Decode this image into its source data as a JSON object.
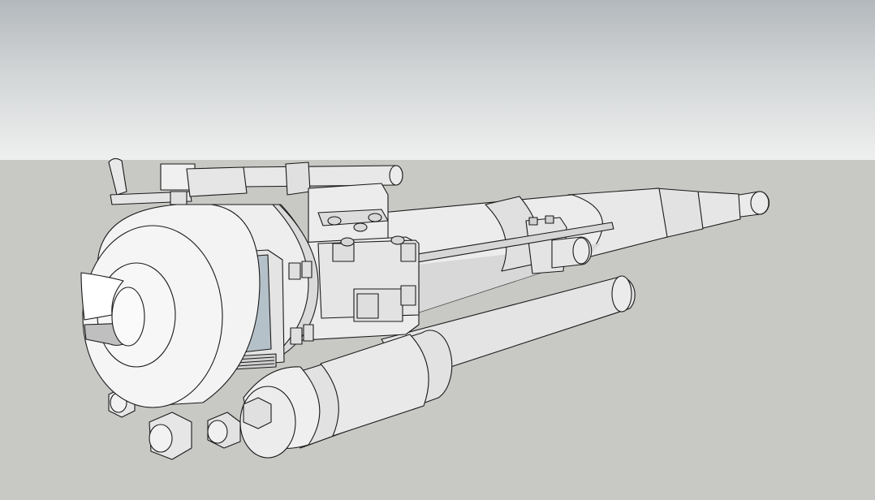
{
  "scene": {
    "kind": "3d-model-viewport",
    "subject": "cannon-assembly-model",
    "colors": {
      "sky_top": "#b3b8bc",
      "sky_bottom": "#eeefef",
      "ground": "#c8c9c5",
      "model_fill": "#ebebeb",
      "model_shade": "#d4d4d4",
      "model_dark": "#bdbdbd",
      "outline": "#1a1a1a",
      "window_glass": "#b5c1c9"
    }
  }
}
